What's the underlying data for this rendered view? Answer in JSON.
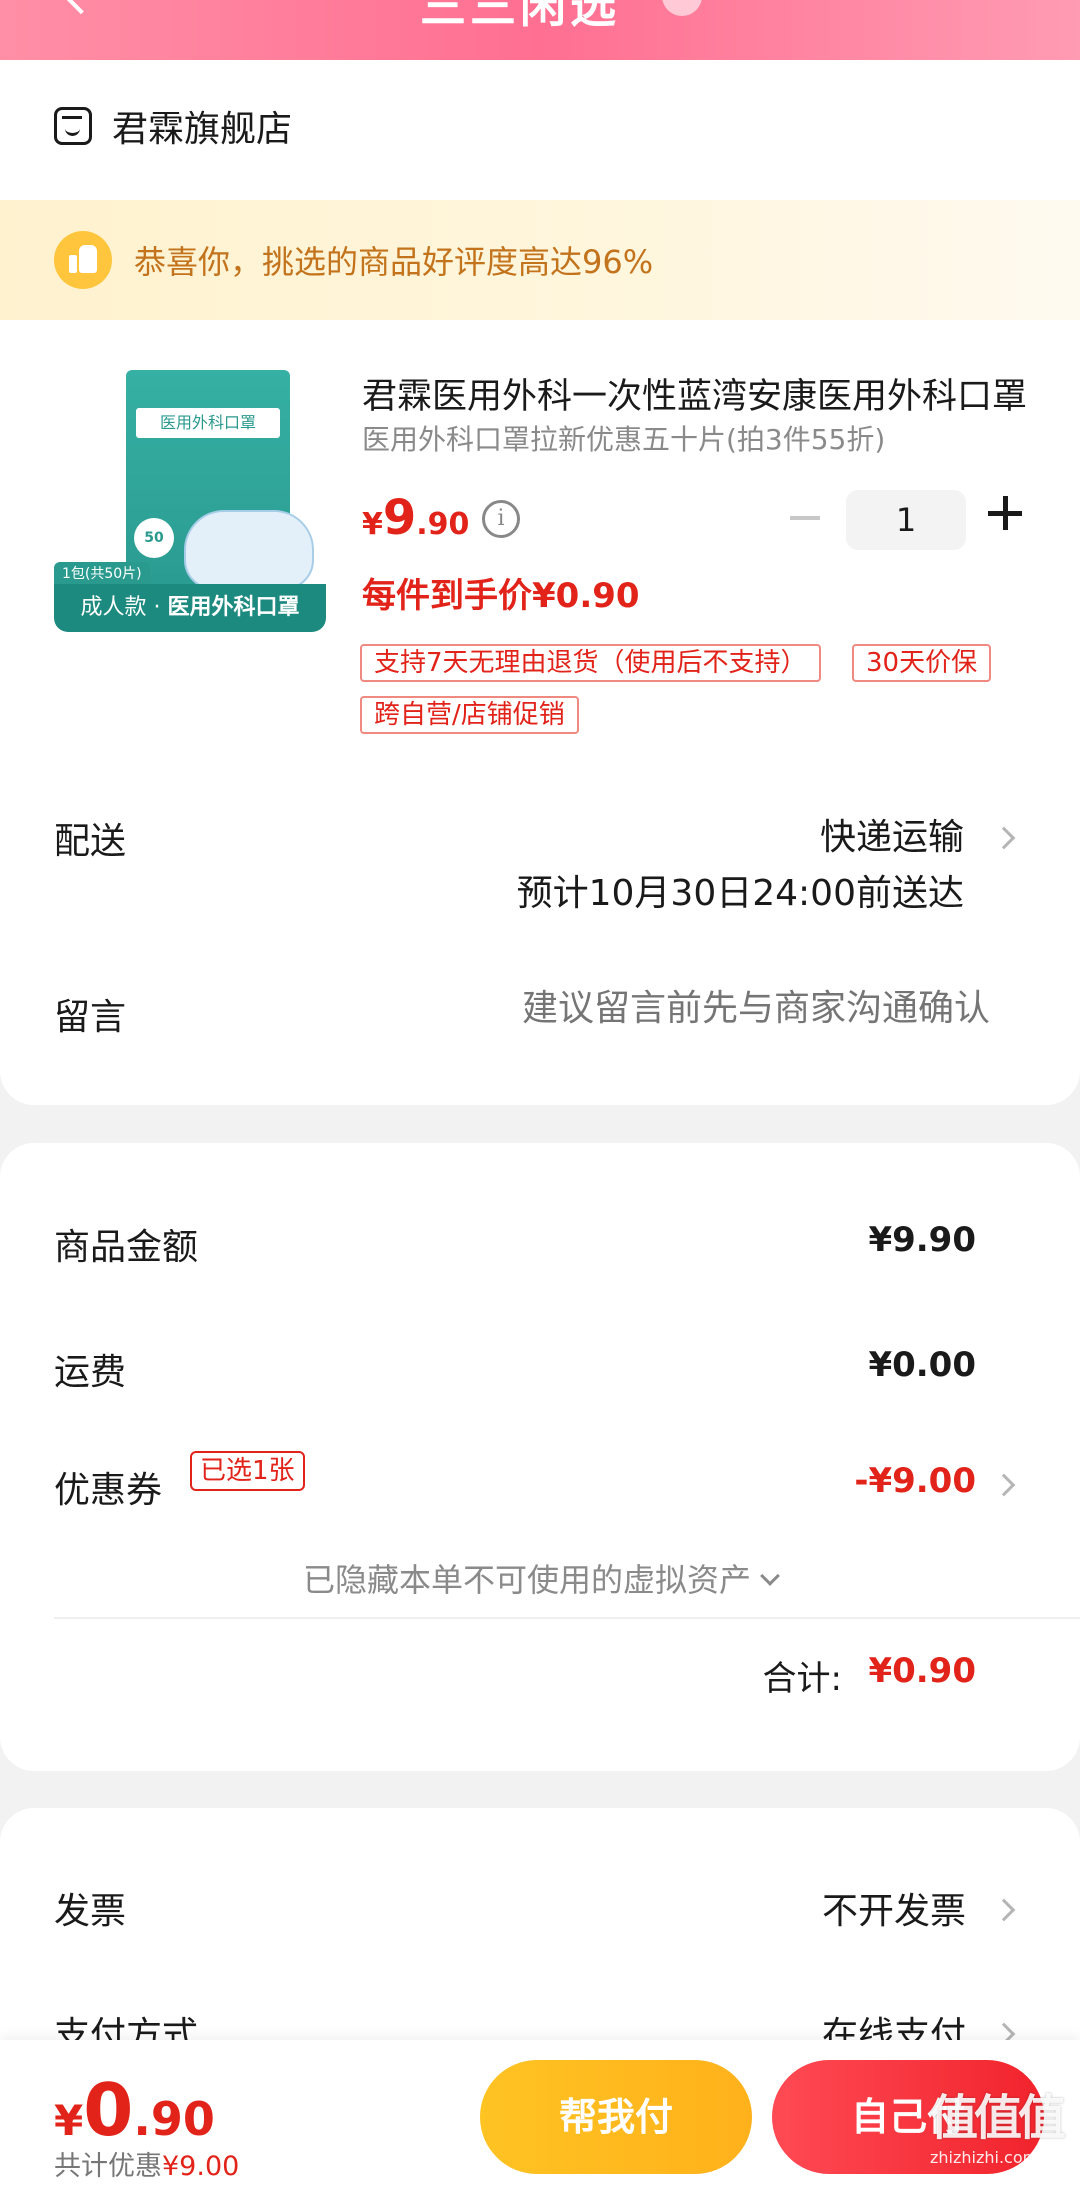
{
  "header": {
    "title": "三三闲选"
  },
  "shop": {
    "name": "君霖旗舰店"
  },
  "congrats": {
    "text": "恭喜你，挑选的商品好评度高达96%"
  },
  "product": {
    "image": {
      "tag": "1包(共50片)",
      "banner_prefix": "成人款 · ",
      "banner_main": "医用外科口罩",
      "pkg_title": "医用外科口罩",
      "pill": "50"
    },
    "title": "君霖医用外科一次性蓝湾安康医用外科口罩",
    "subtitle": "医用外科口罩拉新优惠五十片(拍3件55折)",
    "price": {
      "currency": "¥",
      "integer": "9",
      "decimal": ".90"
    },
    "quantity": "1",
    "each_price": "每件到手价¥0.90",
    "tags": [
      "支持7天无理由退货（使用后不支持）",
      "30天价保",
      "跨自营/店铺促销"
    ]
  },
  "delivery": {
    "label": "配送",
    "method": "快递运输",
    "estimate": "预计10月30日24:00前送达"
  },
  "message": {
    "label": "留言",
    "placeholder": "建议留言前先与商家沟通确认"
  },
  "summary": {
    "goods_label": "商品金额",
    "goods_amount": "¥9.90",
    "shipping_label": "运费",
    "shipping_amount": "¥0.00",
    "coupon_label": "优惠券",
    "coupon_badge": "已选1张",
    "coupon_amount": "-¥9.00",
    "hidden_assets": "已隐藏本单不可使用的虚拟资产",
    "total_label": "合计:",
    "total_amount": "¥0.90"
  },
  "invoice": {
    "label": "发票",
    "value": "不开发票"
  },
  "payment": {
    "label": "支付方式",
    "value": "在线支付"
  },
  "bottom": {
    "price": {
      "currency": "¥",
      "integer": "0",
      "decimal": ".90"
    },
    "savings_prefix": "共计优惠",
    "savings_amount": "¥9.00",
    "help_pay": "帮我付",
    "self_pay": "自己付"
  },
  "watermark": {
    "main": "值值值",
    "sub": "zhizhizhi.com"
  },
  "colors": {
    "accent_red": "#e2231a",
    "help_btn": "#ffbb1f",
    "self_btn": "#f1232c",
    "congrats_text": "#c2731b"
  }
}
